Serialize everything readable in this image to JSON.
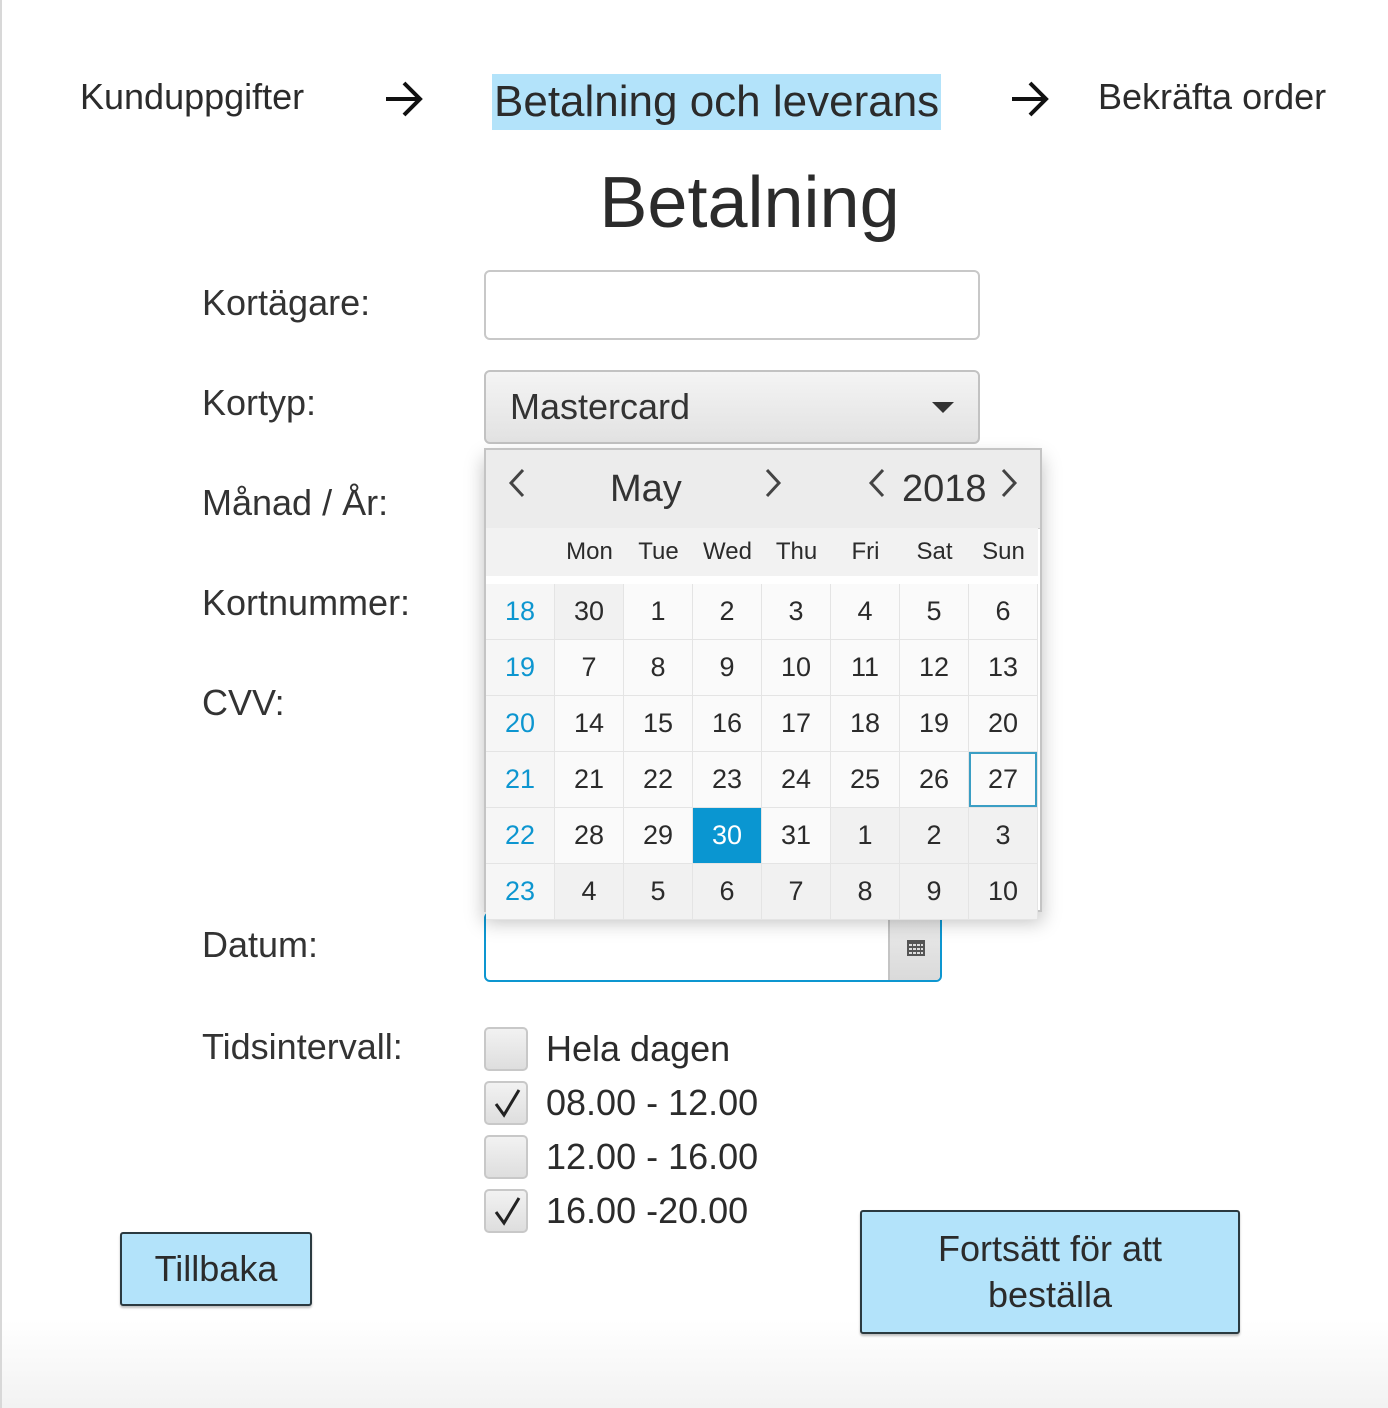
{
  "breadcrumb": {
    "step1": "Kunduppgifter",
    "step2": "Betalning och leverans",
    "step3": "Bekräfta order"
  },
  "page_title": "Betalning",
  "form": {
    "card_holder_label": "Kortägare:",
    "card_holder_value": "",
    "card_type_label": "Kortyp:",
    "card_type_value": "Mastercard",
    "month_year_label": "Månad / År:",
    "card_number_label": "Kortnummer:",
    "cvv_label": "CVV:",
    "date_label": "Datum:",
    "date_value": "",
    "interval_label": "Tidsintervall:"
  },
  "calendar": {
    "month": "May",
    "year": "2018",
    "day_headers": [
      "Mon",
      "Tue",
      "Wed",
      "Thu",
      "Fri",
      "Sat",
      "Sun"
    ],
    "weeks": [
      {
        "week": "18",
        "days": [
          "30",
          "1",
          "2",
          "3",
          "4",
          "5",
          "6"
        ]
      },
      {
        "week": "19",
        "days": [
          "7",
          "8",
          "9",
          "10",
          "11",
          "12",
          "13"
        ]
      },
      {
        "week": "20",
        "days": [
          "14",
          "15",
          "16",
          "17",
          "18",
          "19",
          "20"
        ]
      },
      {
        "week": "21",
        "days": [
          "21",
          "22",
          "23",
          "24",
          "25",
          "26",
          "27"
        ]
      },
      {
        "week": "22",
        "days": [
          "28",
          "29",
          "30",
          "31",
          "1",
          "2",
          "3"
        ]
      },
      {
        "week": "23",
        "days": [
          "4",
          "5",
          "6",
          "7",
          "8",
          "9",
          "10"
        ]
      }
    ],
    "selected_day": "30",
    "today_day": "27",
    "accent_color": "#0a96d1"
  },
  "time_intervals": [
    {
      "label": "Hela dagen",
      "checked": false
    },
    {
      "label": "08.00 - 12.00",
      "checked": true
    },
    {
      "label": "12.00 - 16.00",
      "checked": false
    },
    {
      "label": "16.00 -20.00",
      "checked": true
    }
  ],
  "buttons": {
    "back": "Tillbaka",
    "continue": "Fortsätt för att beställa"
  },
  "colors": {
    "highlight": "#b3e3fa",
    "focus": "#0d96d0"
  }
}
